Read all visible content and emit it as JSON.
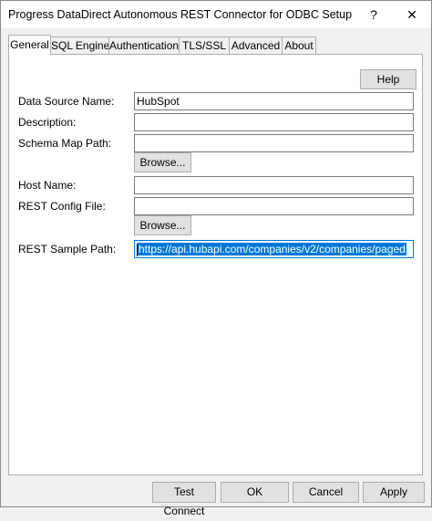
{
  "window": {
    "title": "Progress DataDirect Autonomous REST Connector for ODBC Setup",
    "help_glyph": "?",
    "close_glyph": "✕"
  },
  "tabs": [
    {
      "label": "General",
      "active": true
    },
    {
      "label": "SQL Engine",
      "active": false
    },
    {
      "label": "Authentication",
      "active": false
    },
    {
      "label": "TLS/SSL",
      "active": false
    },
    {
      "label": "Advanced",
      "active": false
    },
    {
      "label": "About",
      "active": false
    }
  ],
  "general": {
    "help_label": "Help",
    "data_source_name": {
      "label": "Data Source Name:",
      "value": "HubSpot"
    },
    "description": {
      "label": "Description:",
      "value": ""
    },
    "schema_map_path": {
      "label": "Schema Map Path:",
      "value": ""
    },
    "browse_label": "Browse...",
    "host_name": {
      "label": "Host Name:",
      "value": ""
    },
    "rest_config_file": {
      "label": "REST Config File:",
      "value": ""
    },
    "rest_sample_path": {
      "label": "REST Sample Path:",
      "value": "https://api.hubapi.com/companies/v2/companies/paged"
    }
  },
  "footer": {
    "test_connect": "Test Connect",
    "ok": "OK",
    "cancel": "Cancel",
    "apply": "Apply"
  },
  "colors": {
    "accent": "#0078d7",
    "selection": "#0078d7"
  }
}
